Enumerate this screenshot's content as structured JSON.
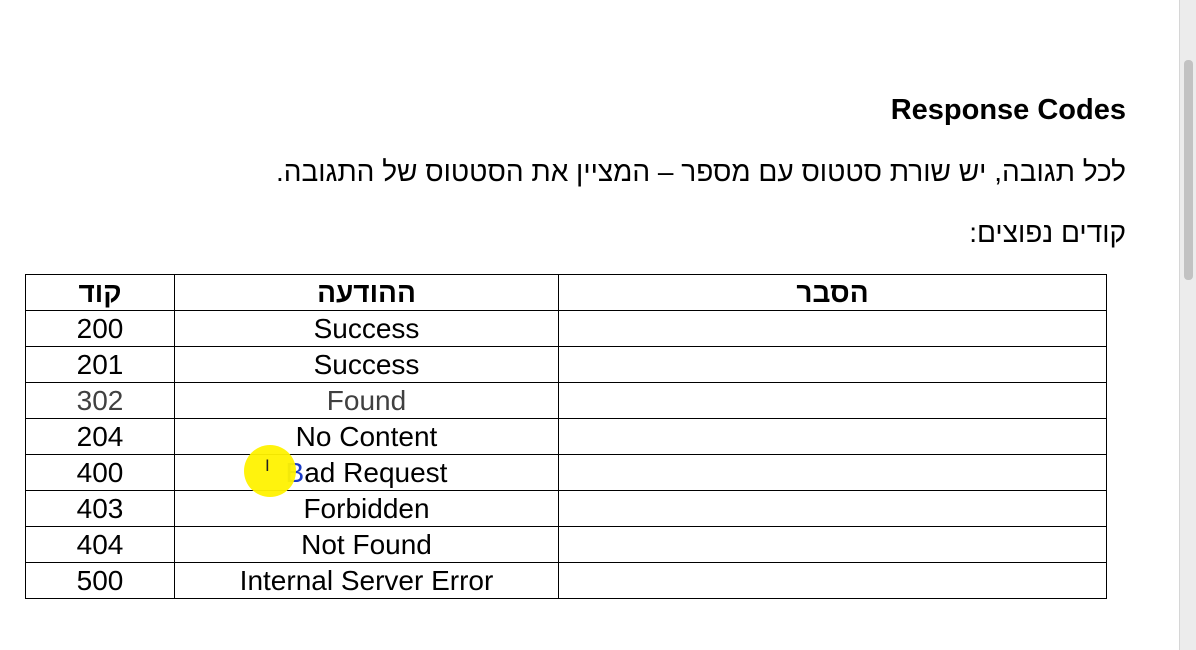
{
  "document": {
    "title": "Response Codes",
    "intro": "לכל תגובה, יש שורת סטטוס עם מספר – המציין את הסטטוס של התגובה.",
    "subhead": "קודים נפוצים:"
  },
  "table": {
    "headers": {
      "code": "קוד",
      "message": "ההודעה",
      "explanation": "הסבר"
    },
    "rows": [
      {
        "code": "200",
        "message": "Success",
        "explanation": ""
      },
      {
        "code": "201",
        "message": "Success",
        "explanation": ""
      },
      {
        "code": "302",
        "message": "Found",
        "explanation": ""
      },
      {
        "code": "204",
        "message": "No Content",
        "explanation": ""
      },
      {
        "code": "400",
        "message_first_letter": "B",
        "message_rest": "ad Request",
        "explanation": ""
      },
      {
        "code": "403",
        "message": "Forbidden",
        "explanation": ""
      },
      {
        "code": "404",
        "message": "Not Found",
        "explanation": ""
      },
      {
        "code": "500",
        "message": "Internal Server Error",
        "explanation": ""
      }
    ]
  },
  "cursor": {
    "glyph": "I",
    "highlight_color": "#fff200"
  },
  "colors": {
    "text": "#000000",
    "selected_letter": "#1a3cc8"
  }
}
